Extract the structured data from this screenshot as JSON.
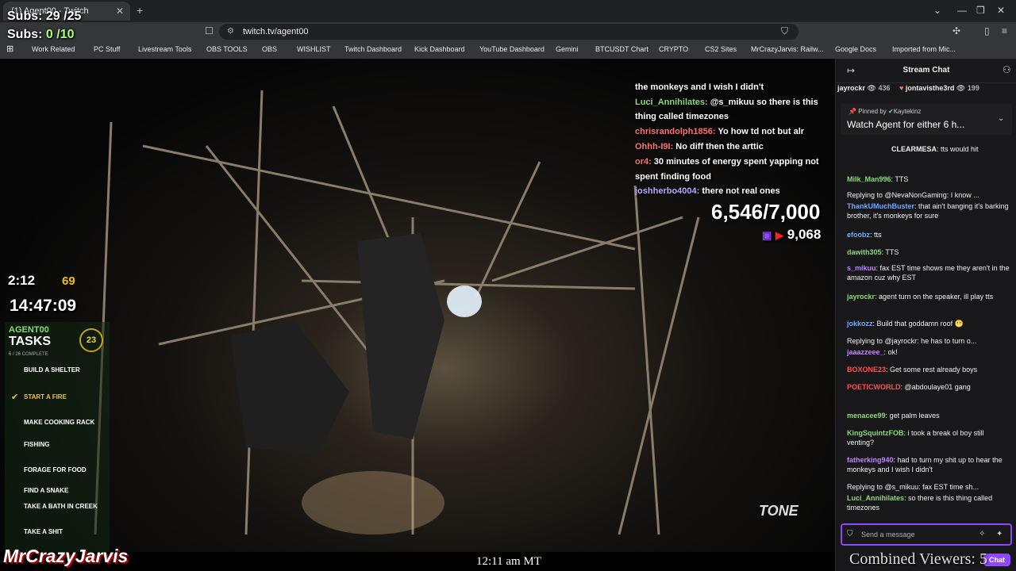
{
  "browser": {
    "tab_title": "(1) Agent00 - Twitch",
    "url": "twitch.tv/agent00",
    "bookmarks": [
      "Work Related",
      "PC Stuff",
      "Livestream Tools",
      "OBS TOOLS",
      "OBS",
      "WISHLIST",
      "Twitch Dashboard",
      "Kick Dashboard",
      "YouTube Dashboard",
      "Gemini",
      "BTCUSDT Chart",
      "CRYPTO",
      "CS2 Sites",
      "MrCrazyJarvis: Railw...",
      "Google Docs",
      "Imported from Mic..."
    ]
  },
  "overlay": {
    "subs_total": "Subs: 29 /25",
    "subs_goal_label": "Subs:",
    "subs_goal_value": "0 /10",
    "stream_chat_lines": [
      {
        "user": "",
        "text": "the monkeys and I wish I didn't"
      },
      {
        "user": "Luci_Annihilates:",
        "text": "@s_mikuu so there is this"
      },
      {
        "user": "",
        "text": "thing called timezones"
      },
      {
        "user": "chrisrandolph1856:",
        "text": "Yo how td not but alr"
      },
      {
        "user": "Ohhh-I9I:",
        "text": "No diff then the arttic"
      },
      {
        "user": "or4:",
        "text": "30 minutes of energy spent yapping not"
      },
      {
        "user": "",
        "text": "spent finding food"
      },
      {
        "user": "joshherbo4004:",
        "text": "there not real ones"
      }
    ],
    "goal_count": "6,546/7,000",
    "viewer_count": "9,068",
    "timer_small": "2:12",
    "timer_small_b": "69",
    "timer_big": "14:47:09",
    "tasks_header": "AGENT00",
    "tasks_title": "TASKS",
    "tasks_badge": "23",
    "tasks_progress": "6 / 26 COMPLETE",
    "tasks": [
      {
        "name": "BUILD A SHELTER",
        "done": false
      },
      {
        "name": "START A FIRE",
        "done": true
      },
      {
        "name": "MAKE COOKING RACK",
        "done": false
      },
      {
        "name": "FISHING",
        "done": false
      },
      {
        "name": "FORAGE FOR FOOD",
        "done": false
      },
      {
        "name": "FIND A SNAKE",
        "done": false
      },
      {
        "name": "TAKE A BATH IN CREEK",
        "done": false
      },
      {
        "name": "TAKE A SHIT",
        "done": false
      }
    ],
    "watermark": "TONE",
    "channel_name": "MrCrazyJarvis",
    "clock": "12:11 am MT",
    "combined_viewers": "Combined Viewers: 5"
  },
  "chat": {
    "header": "Stream Chat",
    "top_users": [
      {
        "name": "jayrockr",
        "count": "436"
      },
      {
        "name": "jontavisthe3rd",
        "count": "199"
      }
    ],
    "pinned_by": "Pinned by",
    "pinned_user": "Kaytekinz",
    "pinned_message": "Watch Agent for either 6 h...",
    "messages": [
      {
        "user": "CLEARMESA",
        "color": "#ffffff",
        "text": "tts would hit",
        "reply": ""
      },
      {
        "user": "Milk_Man996",
        "color": "#8ad878",
        "text": "TTS",
        "reply": ""
      },
      {
        "user": "",
        "color": "#adadb8",
        "text": "",
        "reply": "Replying to @NevaNonGaming: I know ..."
      },
      {
        "user": "ThankUMuchBuster",
        "color": "#6fa8ff",
        "text": "that ain't banging it's barking brother, it's monkeys for sure",
        "reply": ""
      },
      {
        "user": "efoobz",
        "color": "#6fa8ff",
        "text": "tts",
        "reply": ""
      },
      {
        "user": "dawith305",
        "color": "#8ad878",
        "text": "TTS",
        "reply": ""
      },
      {
        "user": "s_mikuu",
        "color": "#c084fc",
        "text": "fax EST time shows me they aren't in the amazon cuz why EST",
        "reply": ""
      },
      {
        "user": "jayrockr",
        "color": "#8ad878",
        "text": "agent turn on the speaker, ill play tts",
        "reply": ""
      },
      {
        "user": "jokkozz",
        "color": "#6fa8ff",
        "text": "Build that goddamn roof",
        "reply": ""
      },
      {
        "user": "",
        "color": "#adadb8",
        "text": "",
        "reply": "Replying to @jayrockr: he has to turn o..."
      },
      {
        "user": "jaaazzeee_",
        "color": "#c084fc",
        "text": "ok!",
        "reply": ""
      },
      {
        "user": "BOXONE23",
        "color": "#ff4f4f",
        "text": "Get some rest already boys",
        "reply": ""
      },
      {
        "user": "POETICWORLD",
        "color": "#ff4f4f",
        "text": "@abdoulaye01 gang",
        "reply": ""
      },
      {
        "user": "menacee99",
        "color": "#8ad878",
        "text": "get palm leaves",
        "reply": ""
      },
      {
        "user": "KingSquintzFOB",
        "color": "#8ad878",
        "text": "i took a break ol boy still venting?",
        "reply": ""
      },
      {
        "user": "fatherking940",
        "color": "#c084fc",
        "text": "had to turn my shit up to hear the monkeys and I wish I didn't",
        "reply": ""
      },
      {
        "user": "",
        "color": "#adadb8",
        "text": "",
        "reply": "Replying to @s_mikuu: fax EST time sh..."
      },
      {
        "user": "Luci_Annihilates",
        "color": "#8ad878",
        "text": "so there is this thing called timezones",
        "reply": ""
      }
    ],
    "input_placeholder": "Send a message",
    "chat_button": "Chat"
  }
}
